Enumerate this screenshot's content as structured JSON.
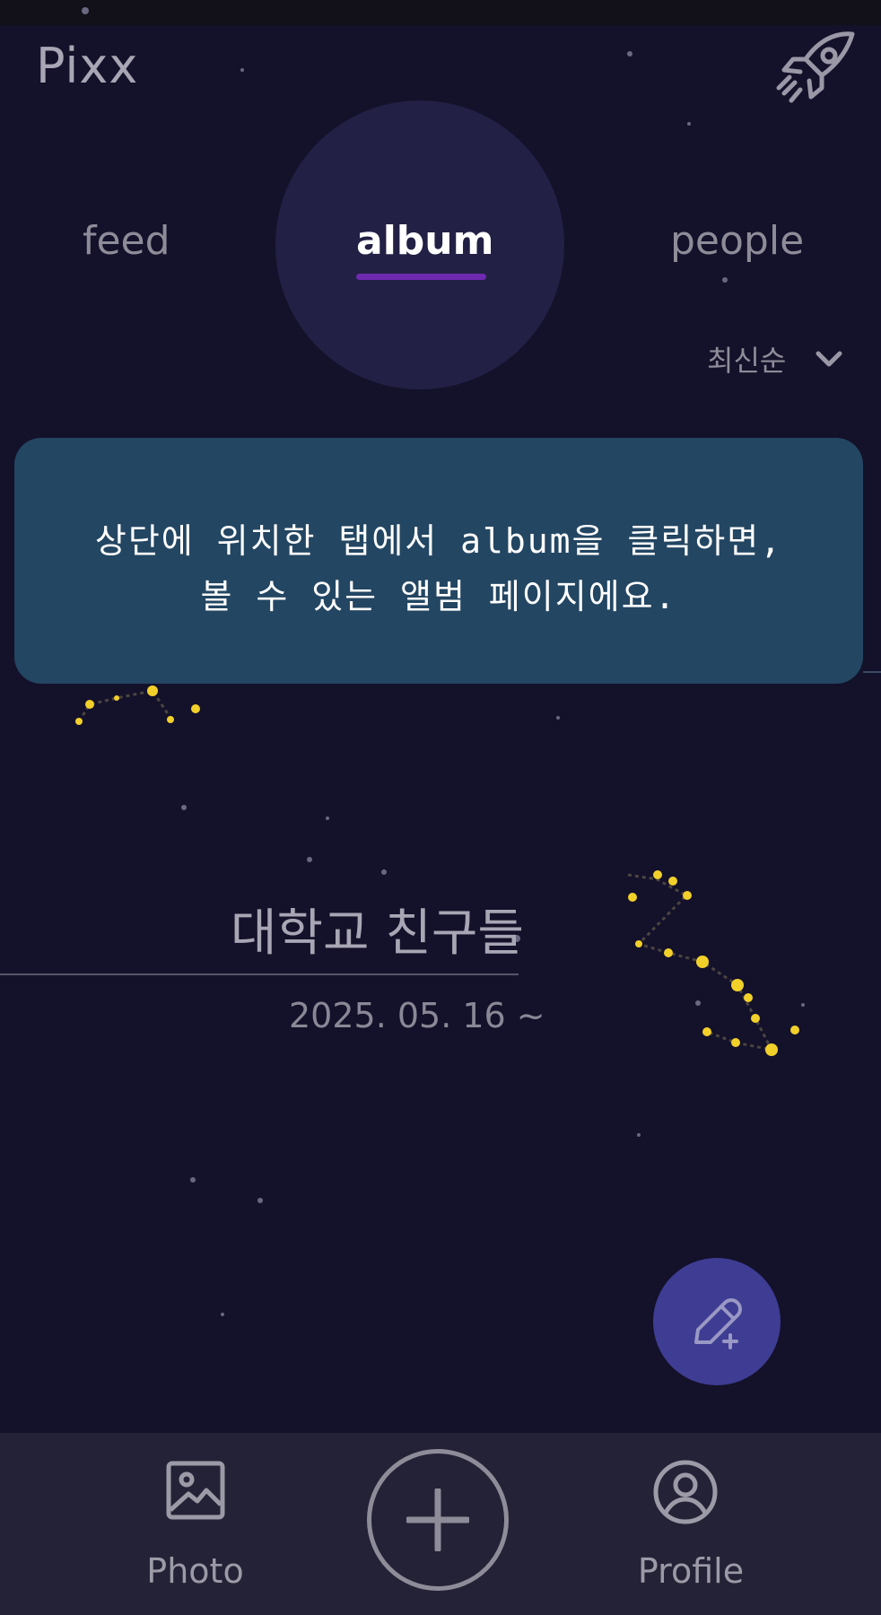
{
  "app": {
    "logo": "Pixx"
  },
  "tabs": [
    {
      "label": "feed",
      "active": false
    },
    {
      "label": "album",
      "active": true
    },
    {
      "label": "people",
      "active": false
    }
  ],
  "sort": {
    "label": "최신순"
  },
  "callout": {
    "line1": "상단에 위치한 탭에서 album을 클릭하면,",
    "line2": "볼 수 있는 앨범 페이지에요."
  },
  "album": {
    "title": "대학교 친구들",
    "date": "2025. 05. 16 ~"
  },
  "bottom_nav": {
    "photo_label": "Photo",
    "profile_label": "Profile"
  },
  "colors": {
    "background": "#14112a",
    "callout": "#234662",
    "active_underline": "#6d2ab0",
    "fab": "#3e3d93",
    "nav_bg": "#242236",
    "star": "#f2d02a"
  },
  "icons": {
    "header": "rocket-icon",
    "sort": "chevron-down-icon",
    "fab": "edit-add-icon",
    "photo": "image-icon",
    "add": "plus-icon",
    "profile": "user-circle-icon"
  }
}
